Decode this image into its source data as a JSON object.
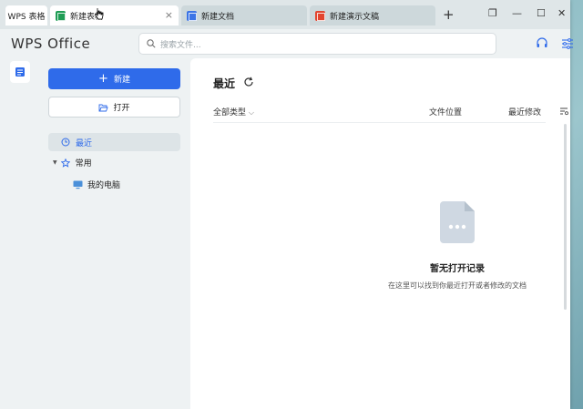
{
  "tabs": {
    "home_label": "WPS 表格",
    "active_label": "新建表格",
    "doc_label": "新建文档",
    "ppt_label": "新建演示文稿",
    "close_glyph": "×",
    "add_glyph": "+"
  },
  "window_controls": {
    "restore_glyph": "❐",
    "minimize_glyph": "—",
    "maximize_glyph": "☐",
    "close_glyph": "✕"
  },
  "header": {
    "logo": "WPS Office",
    "search_placeholder": "搜索文件..."
  },
  "sidebar": {
    "new_label": "新建",
    "open_label": "打开",
    "recent_label": "最近",
    "common_label": "常用",
    "pc_label": "我的电脑"
  },
  "main": {
    "title": "最近",
    "columns": {
      "type": "全部类型",
      "location": "文件位置",
      "modified": "最近修改"
    },
    "empty_title": "暂无打开记录",
    "empty_subtitle": "在这里可以找到你最近打开或者修改的文档"
  },
  "colors": {
    "accent": "#2f6bea",
    "green_tab": "#1f9d55",
    "blue_tab": "#3b74e6",
    "red_tab": "#e2452f"
  },
  "icons": [
    "table-icon",
    "doc-icon",
    "ppt-icon",
    "cursor-icon",
    "search-icon",
    "headset-icon",
    "settings-sliders-icon",
    "recent-icon",
    "star-icon",
    "computer-icon",
    "folder-open-icon",
    "refresh-icon",
    "sort-icon",
    "empty-file-icon"
  ]
}
